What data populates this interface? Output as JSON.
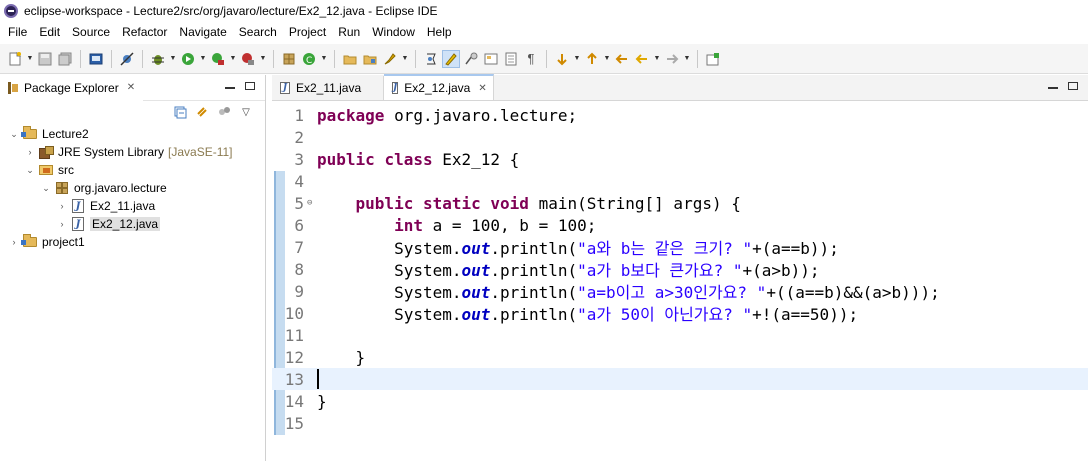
{
  "window": {
    "title": "eclipse-workspace - Lecture2/src/org/javaro/lecture/Ex2_12.java - Eclipse IDE",
    "app_icon": "eclipse-icon"
  },
  "menu": [
    "File",
    "Edit",
    "Source",
    "Refactor",
    "Navigate",
    "Search",
    "Project",
    "Run",
    "Window",
    "Help"
  ],
  "package_explorer": {
    "tab_label": "Package Explorer",
    "tree": [
      {
        "label": "Lecture2",
        "decoration": "",
        "icon": "project-folder-icon",
        "expanded": true,
        "depth": 0
      },
      {
        "label": "JRE System Library",
        "decoration": "[JavaSE-11]",
        "icon": "library-icon",
        "expanded": false,
        "depth": 1
      },
      {
        "label": "src",
        "decoration": "",
        "icon": "source-folder-icon",
        "expanded": true,
        "depth": 1
      },
      {
        "label": "org.javaro.lecture",
        "decoration": "",
        "icon": "package-icon",
        "expanded": true,
        "depth": 2
      },
      {
        "label": "Ex2_11.java",
        "decoration": "",
        "icon": "java-file-icon",
        "expanded": false,
        "depth": 3
      },
      {
        "label": "Ex2_12.java",
        "decoration": "",
        "icon": "java-file-icon",
        "expanded": false,
        "depth": 3,
        "selected": true
      },
      {
        "label": "project1",
        "decoration": "",
        "icon": "project-folder-icon",
        "expanded": false,
        "depth": 0
      }
    ]
  },
  "editor": {
    "tabs": [
      {
        "label": "Ex2_11.java",
        "active": false
      },
      {
        "label": "Ex2_12.java",
        "active": true
      }
    ],
    "line_numbers": [
      "1",
      "2",
      "3",
      "4",
      "5",
      "6",
      "7",
      "8",
      "9",
      "10",
      "11",
      "12",
      "13",
      "14",
      "15"
    ],
    "lines": [
      "package org.javaro.lecture;",
      "",
      "public class Ex2_12 {",
      "",
      "    public static void main(String[] args) {",
      "        int a = 100, b = 100;",
      "        System.out.println(\"a와 b는 같은 크기? \"+(a==b));",
      "        System.out.println(\"a가 b보다 큰가요? \"+(a>b));",
      "        System.out.println(\"a=b이고 a>30인가요? \"+((a==b)&&(a>b)));",
      "        System.out.println(\"a가 50이 아닌가요? \"+!(a==50));",
      "",
      "    }",
      "",
      "}",
      ""
    ],
    "current_line": 13
  },
  "colors": {
    "keyword": "#7f0055",
    "string": "#2a00ff",
    "static_field": "#0000c0",
    "current_line_bg": "#e8f2fe"
  }
}
